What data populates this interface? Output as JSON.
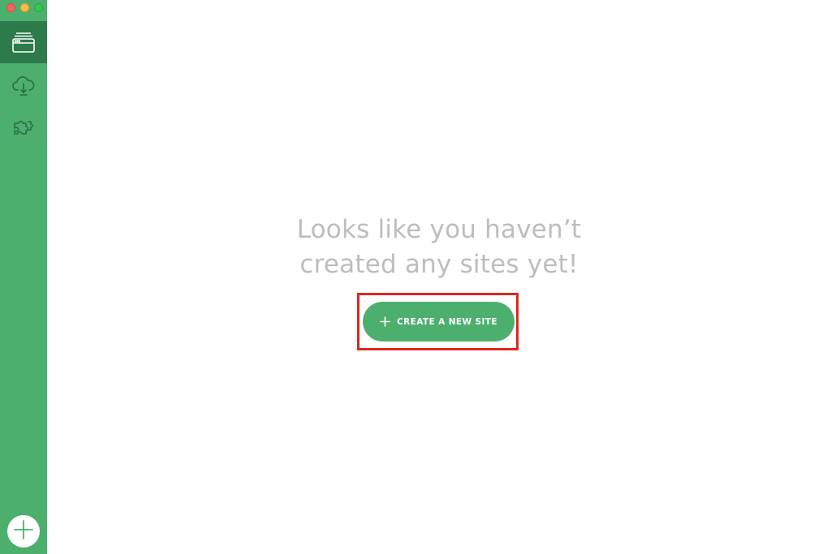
{
  "window": {
    "controls": [
      "close",
      "minimize",
      "maximize"
    ]
  },
  "sidebar": {
    "items": [
      {
        "id": "sites",
        "icon": "browser-window-icon",
        "active": true
      },
      {
        "id": "connect",
        "icon": "cloud-download-icon",
        "active": false
      },
      {
        "id": "addons",
        "icon": "puzzle-pieces-icon",
        "active": false
      }
    ],
    "add_icon": "plus-icon"
  },
  "main": {
    "empty_title_line1": "Looks like you haven’t",
    "empty_title_line2": "created any sites yet!",
    "create_button_label": "CREATE A NEW SITE"
  },
  "colors": {
    "sidebar": "#4caf6e",
    "sidebar_active": "#2d7a4b",
    "button": "#4caf6e",
    "text_muted": "#bdbdbd",
    "highlight": "#e0261e"
  }
}
